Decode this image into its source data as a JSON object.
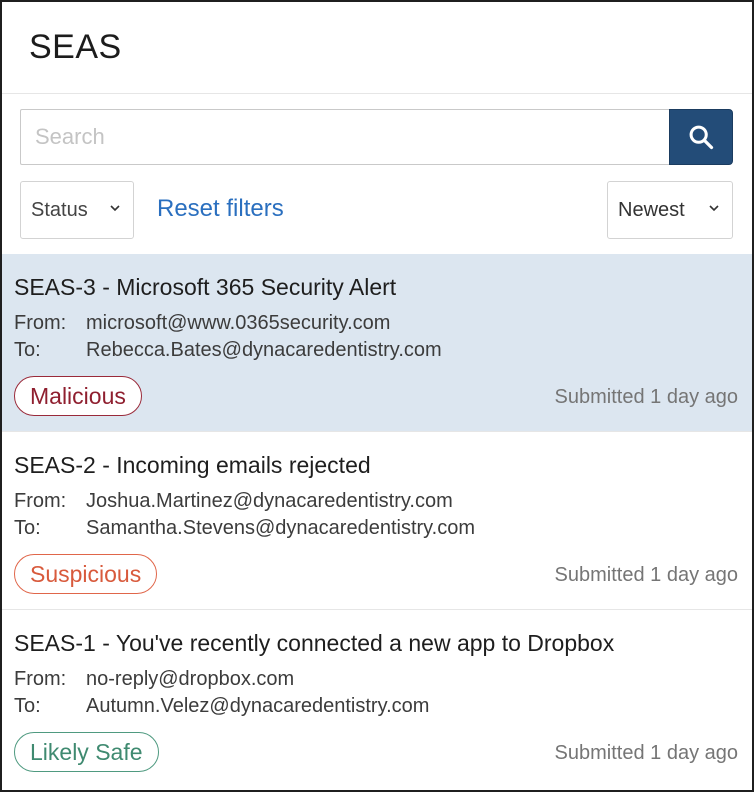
{
  "header": {
    "title": "SEAS"
  },
  "search": {
    "placeholder": "Search",
    "value": ""
  },
  "filters": {
    "status_label": "Status",
    "reset_label": "Reset filters",
    "sort_label": "Newest"
  },
  "labels": {
    "from": "From:",
    "to": "To:"
  },
  "items": [
    {
      "title": "SEAS-3 - Microsoft 365 Security Alert",
      "from": "microsoft@www.0365security.com",
      "to": "Rebecca.Bates@dynacaredentistry.com",
      "status": "Malicious",
      "submitted": "Submitted 1 day ago"
    },
    {
      "title": "SEAS-2 - Incoming emails rejected",
      "from": "Joshua.Martinez@dynacaredentistry.com",
      "to": "Samantha.Stevens@dynacaredentistry.com",
      "status": "Suspicious",
      "submitted": "Submitted 1 day ago"
    },
    {
      "title": "SEAS-1 - You've recently connected a new app to Dropbox",
      "from": "no-reply@dropbox.com",
      "to": "Autumn.Velez@dynacaredentistry.com",
      "status": "Likely Safe",
      "submitted": "Submitted 1 day ago"
    }
  ],
  "colors": {
    "accent": "#234c78",
    "selected_row": "#dce6f0",
    "malicious": "#8f1f2f",
    "suspicious": "#d85a3c",
    "likely_safe": "#3f8a70",
    "link": "#2a6fbf"
  }
}
